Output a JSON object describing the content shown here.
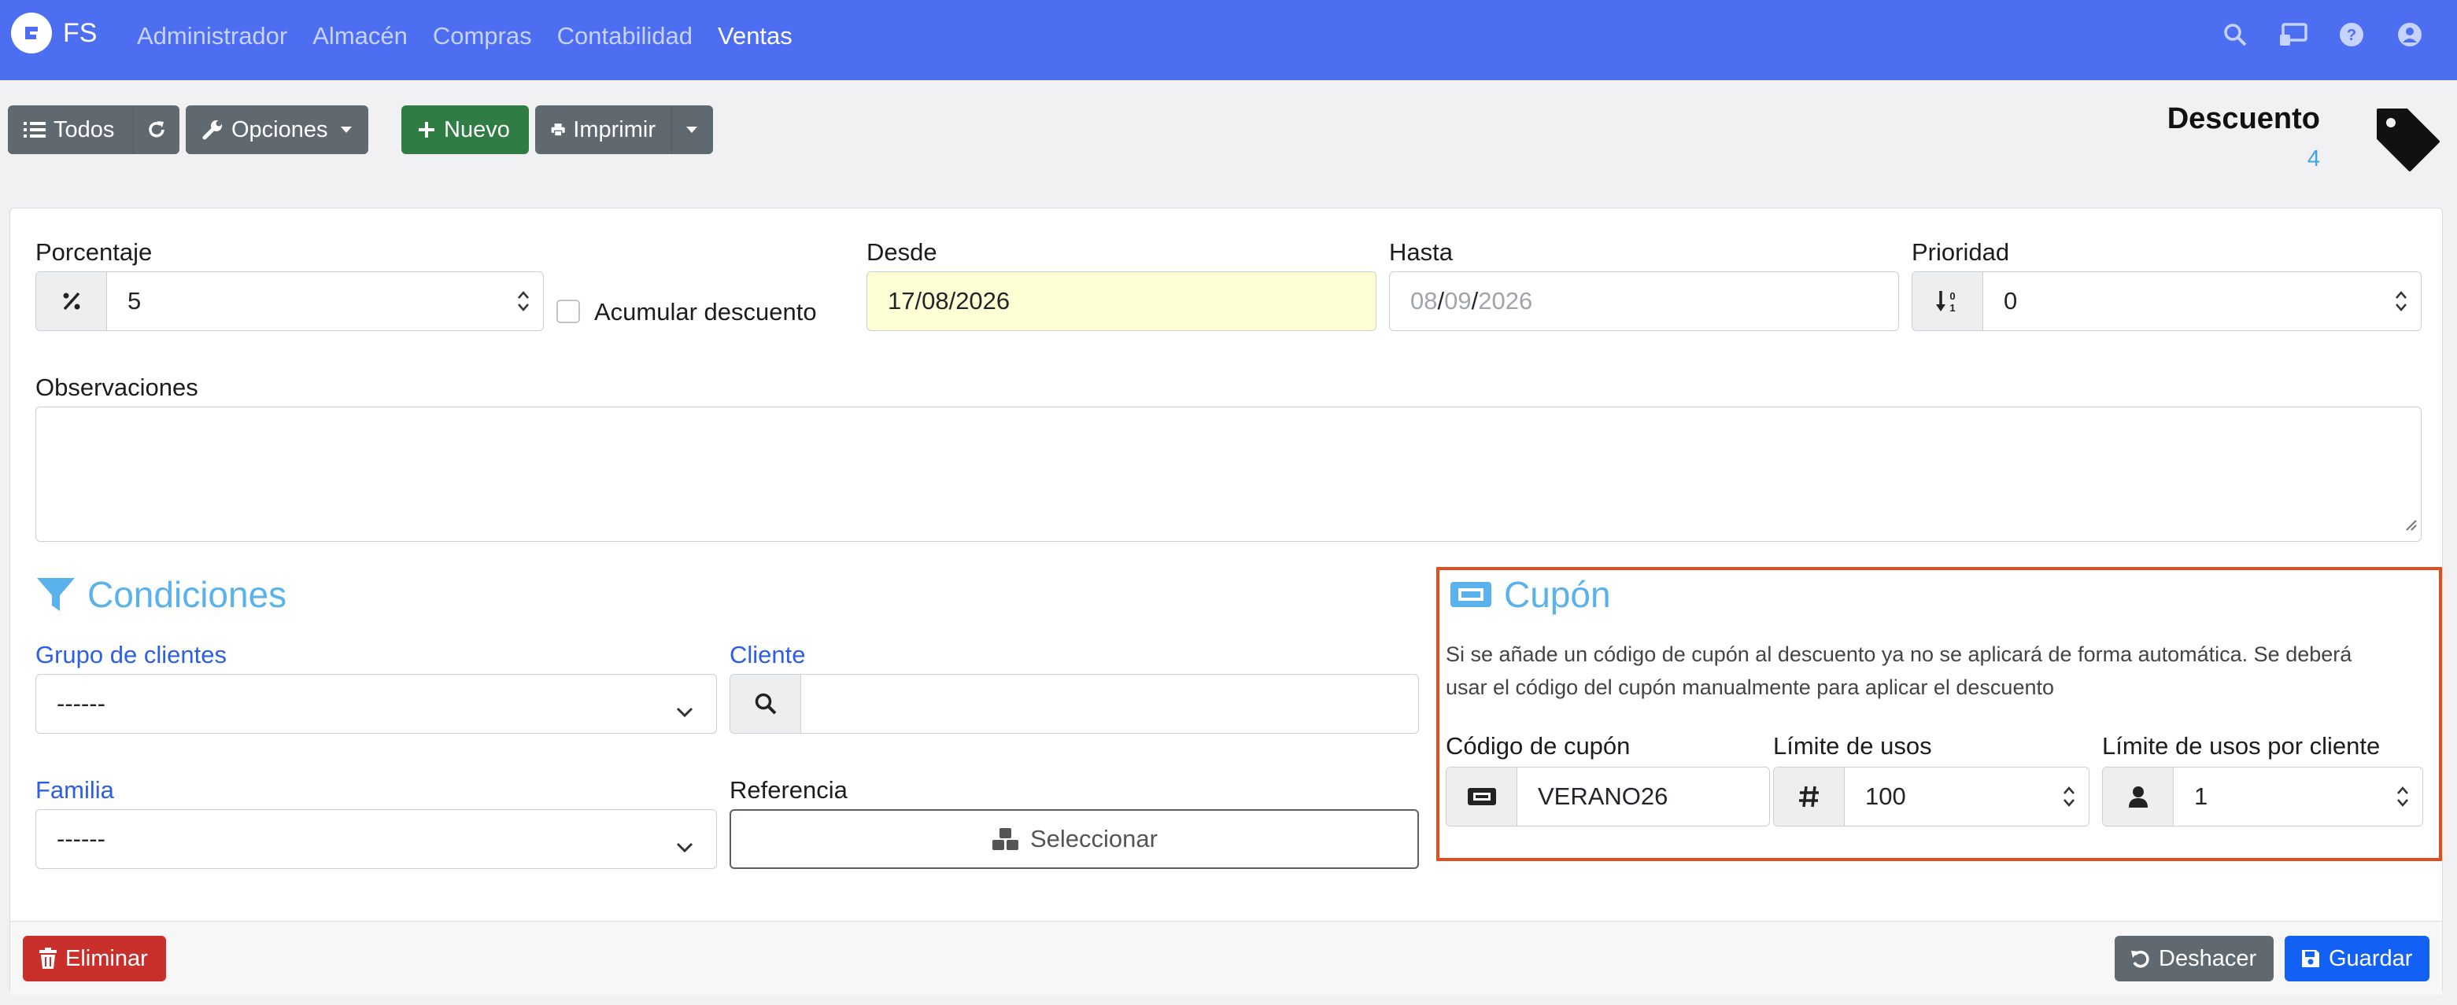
{
  "nav": {
    "brand": "FS",
    "menu": [
      "Administrador",
      "Almacén",
      "Compras",
      "Contabilidad",
      "Ventas"
    ],
    "active": "Ventas",
    "icons": [
      "search-icon",
      "cast-icon",
      "help-icon",
      "user-icon"
    ]
  },
  "toolbar": {
    "all_label": "Todos",
    "options_label": "Opciones",
    "new_label": "Nuevo",
    "print_label": "Imprimir"
  },
  "header": {
    "title": "Descuento",
    "code": "4",
    "icon": "tag-icon"
  },
  "form": {
    "porcentaje": {
      "label": "Porcentaje",
      "value": "5"
    },
    "acumular": {
      "label": "Acumular descuento",
      "checked": false
    },
    "desde": {
      "label": "Desde",
      "value": "17/08/2026"
    },
    "hasta": {
      "label": "Hasta",
      "day": "08",
      "month": "09",
      "year": "2026",
      "sep": "/"
    },
    "prioridad": {
      "label": "Prioridad",
      "value": "0"
    },
    "observaciones": {
      "label": "Observaciones",
      "value": ""
    }
  },
  "condiciones": {
    "title": "Condiciones",
    "grupo": {
      "label": "Grupo de clientes",
      "value": "------"
    },
    "cliente": {
      "label": "Cliente",
      "value": ""
    },
    "familia": {
      "label": "Familia",
      "value": "------"
    },
    "referencia": {
      "label": "Referencia",
      "button": "Seleccionar"
    }
  },
  "cupon": {
    "title": "Cupón",
    "note_line1": "Si se añade un código de cupón al descuento ya no se aplicará de forma automática. Se deberá",
    "note_line2": "usar el código del cupón manualmente para aplicar el descuento",
    "codigo": {
      "label": "Código de cupón",
      "value": "VERANO26"
    },
    "limite": {
      "label": "Límite de usos",
      "value": "100"
    },
    "limite_cliente": {
      "label": "Límite de usos por cliente",
      "value": "1"
    }
  },
  "footer": {
    "delete_label": "Eliminar",
    "undo_label": "Deshacer",
    "save_label": "Guardar"
  },
  "colors": {
    "navbar": "#4e6ef2",
    "accent": "#5ab2ec",
    "highlight_border": "#e04e1b",
    "date_highlight": "#ffffd6"
  }
}
